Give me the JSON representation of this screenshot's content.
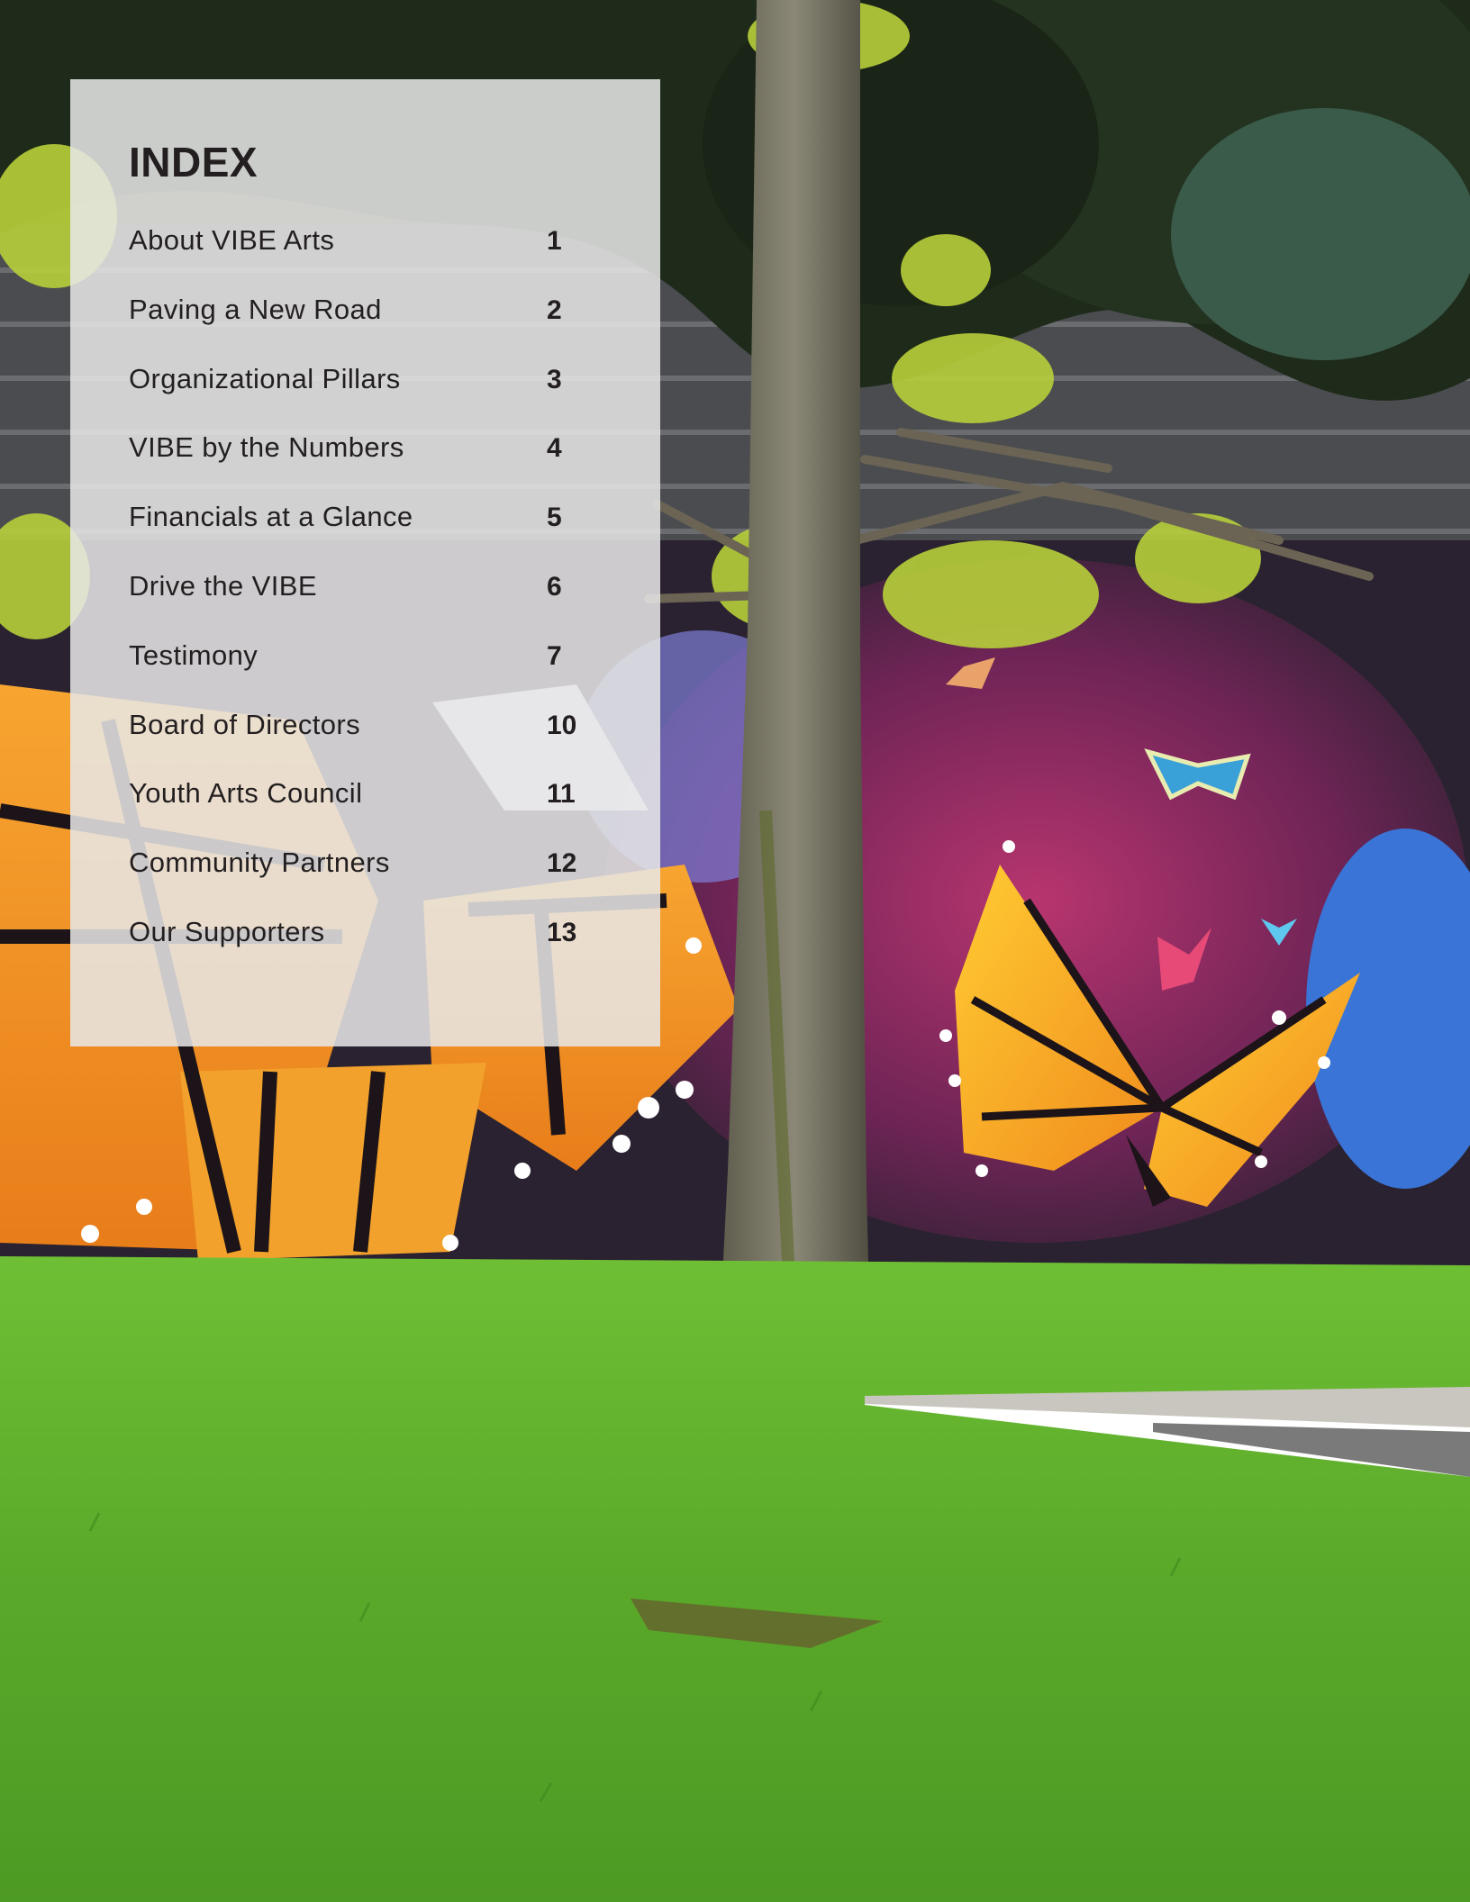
{
  "index": {
    "title": "INDEX",
    "entries": [
      {
        "label": "About VIBE Arts",
        "page": "1"
      },
      {
        "label": "Paving a New Road",
        "page": "2"
      },
      {
        "label": "Organizational Pillars",
        "page": "3"
      },
      {
        "label": "VIBE by the Numbers",
        "page": "4"
      },
      {
        "label": "Financials at a Glance",
        "page": "5"
      },
      {
        "label": "Drive the VIBE",
        "page": "6"
      },
      {
        "label": "Testimony",
        "page": "7"
      },
      {
        "label": "Board of Directors",
        "page": "10"
      },
      {
        "label": "Youth Arts Council",
        "page": "11"
      },
      {
        "label": "Community Partners",
        "page": "12"
      },
      {
        "label": "Our Supporters",
        "page": "13"
      }
    ]
  },
  "colors": {
    "text": "#231f20",
    "panel": "#e8e8e8",
    "grass": "#5fae2e",
    "mural_wall": "#2a2230"
  }
}
